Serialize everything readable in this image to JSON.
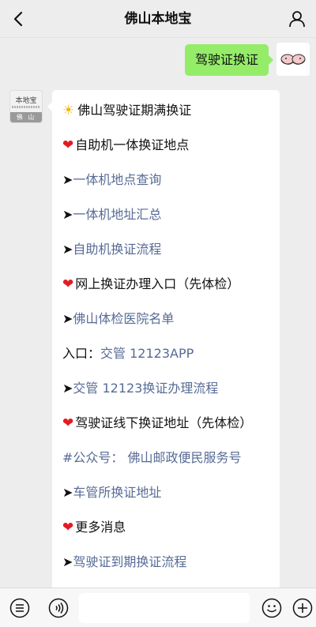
{
  "header": {
    "title": "佛山本地宝"
  },
  "outgoing": {
    "text": "驾驶证换证"
  },
  "incoming": {
    "avatar_text": "本地宝",
    "avatar_city": "佛 山",
    "lines": [
      {
        "prefix": "sun",
        "text": "佛山驾驶证期满换证",
        "link": false
      },
      {
        "prefix": "heart",
        "text": "自助机一体换证地点",
        "link": false
      },
      {
        "prefix": "arrow",
        "text": "一体机地点查询",
        "link": true
      },
      {
        "prefix": "arrow",
        "text": "一体机地址汇总",
        "link": true
      },
      {
        "prefix": "arrow",
        "text": "自助机换证流程",
        "link": true
      },
      {
        "prefix": "heart",
        "text": "网上换证办理入口（先体检）",
        "link": false
      },
      {
        "prefix": "arrow",
        "text": "佛山体检医院名单",
        "link": true
      },
      {
        "prefix": "entry",
        "label": "入口：",
        "text": "交管 12123APP",
        "link": true
      },
      {
        "prefix": "arrow",
        "text": "交管 12123换证办理流程",
        "link": true
      },
      {
        "prefix": "heart",
        "text": "驾驶证线下换证地址（先体检）",
        "link": false
      },
      {
        "prefix": "tag",
        "text": "#公众号： 佛山邮政便民服务号",
        "link": true
      },
      {
        "prefix": "arrow",
        "text": "车管所换证地址",
        "link": true
      },
      {
        "prefix": "heart",
        "text": "更多消息",
        "link": false
      },
      {
        "prefix": "arrow",
        "text": "驾驶证到期换证流程",
        "link": true
      }
    ]
  },
  "colors": {
    "outgoing_bubble": "#95ec69",
    "link": "#576b95",
    "heart": "#e31b23",
    "background": "#ededed"
  },
  "icons": {
    "back": "chevron-left-icon",
    "profile": "person-icon",
    "menu": "menu-list-icon",
    "voice": "voice-icon",
    "emoji": "emoji-icon",
    "add": "plus-circle-icon"
  }
}
